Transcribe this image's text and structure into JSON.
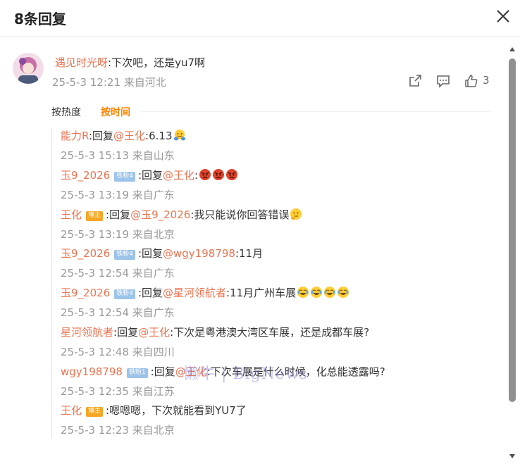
{
  "header": {
    "title": "8条回复"
  },
  "main_comment": {
    "username": "遇见时光呀",
    "text": ":下次吧，还是yu7啊",
    "time": "25-5-3 12:21",
    "location": "来自河北",
    "like_count": "3"
  },
  "sort_tabs": {
    "hot": "按热度",
    "time": "按时间"
  },
  "replies": [
    {
      "name": "能力R",
      "badge": "",
      "badge_type": "",
      "pre": ":回复",
      "mention": "@王化",
      "text": ":6.13",
      "emoji": "hug",
      "emoji_count": 1,
      "time": "25-5-3 15:13",
      "location": "来自山东"
    },
    {
      "name": "玉9_2026",
      "badge": "铁粉4",
      "badge_type": "fan",
      "pre": ":回复",
      "mention": "@王化",
      "text": ":",
      "emoji": "angry",
      "emoji_count": 3,
      "time": "25-5-3 13:19",
      "location": "来自广东"
    },
    {
      "name": "王化",
      "badge": "博主",
      "badge_type": "blog",
      "pre": ":回复",
      "mention": "@玉9_2026",
      "text": ":我只能说你回答错误",
      "emoji": "think",
      "emoji_count": 1,
      "time": "25-5-3 13:19",
      "location": "来自北京"
    },
    {
      "name": "玉9_2026",
      "badge": "铁粉4",
      "badge_type": "fan",
      "pre": ":回复",
      "mention": "@wgy198798",
      "text": ":11月",
      "emoji": "",
      "emoji_count": 0,
      "time": "25-5-3 12:54",
      "location": "来自广东"
    },
    {
      "name": "玉9_2026",
      "badge": "铁粉4",
      "badge_type": "fan",
      "pre": ":回复",
      "mention": "@星河领航者",
      "text": ":11月广州车展",
      "emoji": "laugh",
      "emoji_count": 4,
      "time": "25-5-3 12:54",
      "location": "来自广东"
    },
    {
      "name": "星河领航者",
      "badge": "",
      "badge_type": "",
      "pre": ":回复",
      "mention": "@王化",
      "text": ":下次是粤港澳大湾区车展，还是成都车展?",
      "emoji": "",
      "emoji_count": 0,
      "time": "25-5-3 12:48",
      "location": "来自四川"
    },
    {
      "name": "wgy198798",
      "badge": "铁粉1",
      "badge_type": "fan",
      "pre": ":回复",
      "mention": "@王化",
      "text": ":下次车展是什么时候，化总能透露吗?",
      "emoji": "",
      "emoji_count": 0,
      "time": "25-5-3 12:35",
      "location": "来自江苏"
    },
    {
      "name": "王化",
      "badge": "博主",
      "badge_type": "blog",
      "pre": "",
      "mention": "",
      "text": ":嗯嗯嗯，下次就能看到YU7了",
      "emoji": "",
      "emoji_count": 0,
      "time": "25-5-3 12:23",
      "location": "来自北京"
    }
  ],
  "watermark": "懒牛 | BigNews",
  "icons": {
    "close": "close-icon",
    "share": "share-icon",
    "comment": "comment-icon",
    "like": "thumbs-up-icon"
  },
  "colors": {
    "username": "#eb7350",
    "active_tab": "#ff8200",
    "meta": "#999999"
  }
}
